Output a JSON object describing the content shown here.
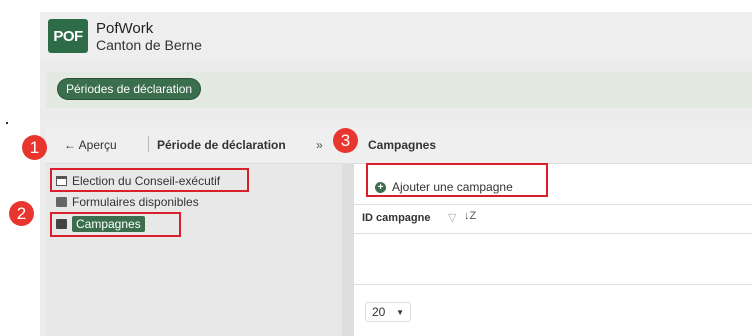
{
  "header": {
    "logo_text": "POF",
    "app_name": "PofWork",
    "org_name": "Canton de Berne"
  },
  "topbar": {
    "pill_label": "Périodes de déclaration"
  },
  "navbar": {
    "back_label": "← Aperçu",
    "crumb": "Période de déclaration",
    "separator": "»",
    "section_title": "Campagnes"
  },
  "tree": {
    "items": [
      {
        "label": "Election du Conseil-exécutif",
        "icon": "calendar-icon"
      },
      {
        "label": "Formulaires disponibles",
        "icon": "document-icon"
      },
      {
        "label": "Campagnes",
        "icon": "folder-icon",
        "selected": true
      }
    ]
  },
  "main": {
    "add_button": "Ajouter une campagne",
    "column_header": "ID campagne",
    "filter_glyph": "▽",
    "sort_glyph": "↓Z",
    "page_size": "20"
  },
  "annotations": [
    "1",
    "2",
    "3"
  ],
  "colors": {
    "brand_green": "#3b6e4d",
    "annotation_red": "#d8202c"
  }
}
